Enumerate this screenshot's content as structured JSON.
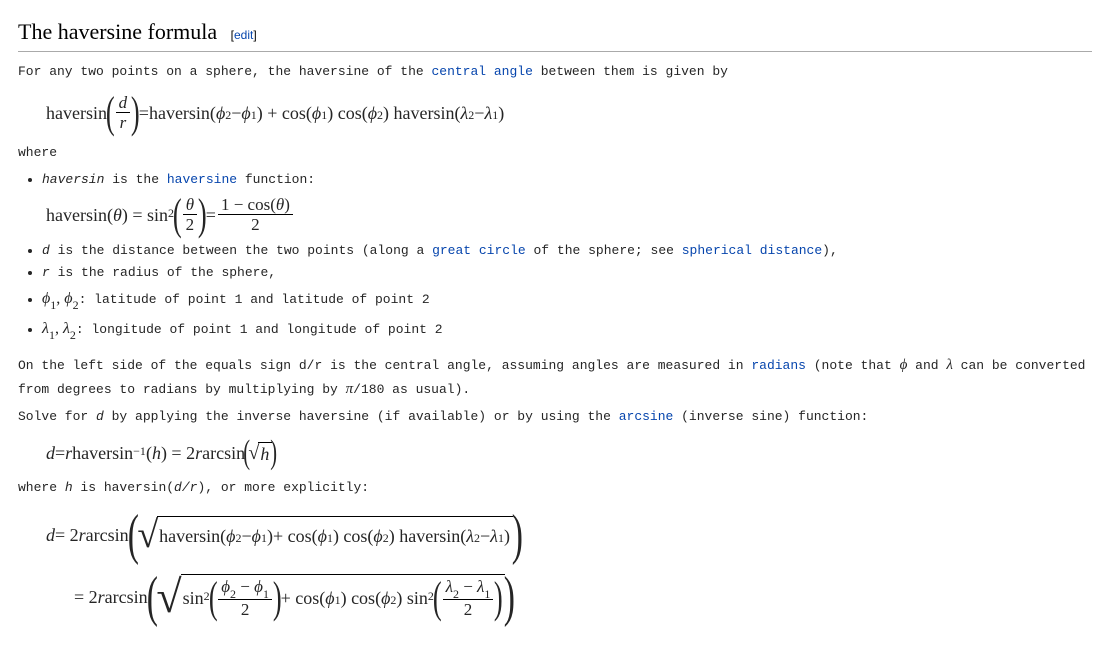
{
  "heading": "The haversine formula",
  "edit_open": "[",
  "edit_label": "edit",
  "edit_close": "]",
  "intro_pre": "For any two points on a sphere, the haversine of the ",
  "intro_link": "central angle",
  "intro_post": " between them is given by",
  "f1": {
    "hav": "haversin",
    "d": "d",
    "r": "r",
    "eq": " = ",
    "rhs_a": "haversin(",
    "phi2": "ϕ",
    "sub2": "2",
    "minus": " − ",
    "phi1": "ϕ",
    "sub1": "1",
    "rhs_b": ") + cos(",
    "rhs_c": ") cos(",
    "rhs_d": ") haversin(",
    "lam": "λ",
    "close": ")"
  },
  "where": "where",
  "li1_a": "haversin",
  "li1_b": " is the ",
  "li1_link": "haversine",
  "li1_c": " function:",
  "f2": {
    "lhs": "haversin(",
    "theta": "θ",
    "rp": ") = sin",
    "sq": "2",
    "two": "2",
    "eq": " = ",
    "num": "1 − cos(",
    "num2": ")",
    "den": "2"
  },
  "li2_a": "d",
  "li2_b": " is the distance between the two points (along a ",
  "li2_link1": "great circle",
  "li2_c": " of the sphere; see ",
  "li2_link2": "spherical distance",
  "li2_d": "),",
  "li3_a": "r",
  "li3_b": " is the radius of the sphere,",
  "li4_a": "ϕ",
  "li4_s1": "1",
  "li4_sep": ", ",
  "li4_s2": "2",
  "li4_b": ": latitude of point 1 and latitude of point 2",
  "li5_a": "λ",
  "li5_b": ": longitude of point 1 and longitude of point 2",
  "p2_a": "On the left side of the equals sign ",
  "p2_dr": "d/r",
  "p2_b": " is the central angle, assuming angles are measured in ",
  "p2_link": "radians",
  "p2_c": " (note that ",
  "p2_phi": "ϕ",
  "p2_and": " and ",
  "p2_lam": "λ",
  "p2_d": " can be converted from degrees to radians by multiplying by ",
  "p2_pi": "π",
  "p2_e": "/180 as usual).",
  "p3_a": "Solve for ",
  "p3_d": "d",
  "p3_b": " by applying the inverse haversine (if available) or by using the ",
  "p3_link": "arcsine",
  "p3_c": " (inverse sine) function:",
  "f3": {
    "d": "d",
    "eq": " = ",
    "r": "r",
    "hav": " haversin",
    "neg1": "−1",
    "h": "h",
    "eq2": ") = 2",
    "arcsin": " arcsin ",
    "open": "(",
    "close": ")"
  },
  "p4_a": "where ",
  "p4_h": "h",
  "p4_b": " is haversin(",
  "p4_dr": "d/r",
  "p4_c": "), or more explicitly:",
  "f4": {
    "d": "d",
    "eq": " = 2",
    "r": "r",
    "arcsin": " arcsin ",
    "hav": "haversin(",
    "cos": " + cos(",
    "cos2": ") cos(",
    "hav2": ") haversin(",
    "sin2": "sin",
    "sq": "2"
  }
}
